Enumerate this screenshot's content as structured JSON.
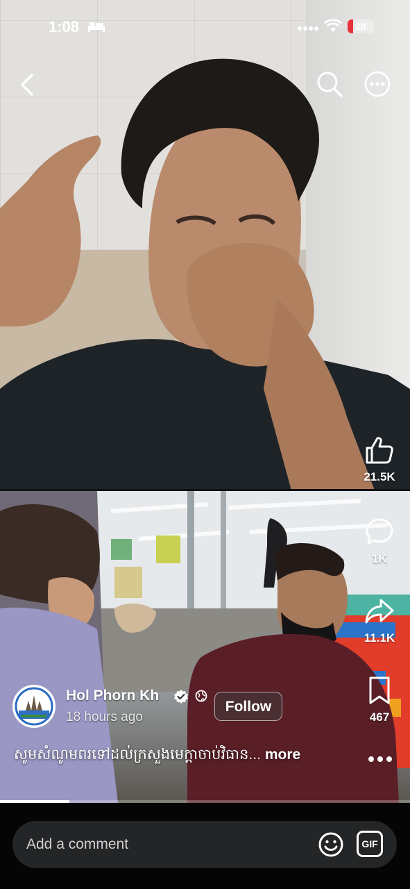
{
  "status_bar": {
    "time": "1:08",
    "battery_percent": 20,
    "battery_label": "20",
    "battery_color": "#e5323b",
    "icons": [
      "bed-icon",
      "signal-icon",
      "wifi-icon",
      "battery-icon"
    ]
  },
  "header": {
    "icons": [
      "back-icon",
      "search-icon",
      "more-circle-icon"
    ]
  },
  "actions": {
    "like_count": "21.5K",
    "comment_count": "1K",
    "share_count": "11.1K",
    "save_count": "467"
  },
  "post": {
    "author": "Hol Phorn Kh",
    "time_ago": "18 hours ago",
    "follow_label": "Follow",
    "caption": "សូមសំណូមពរទៅដល់ក្រសួងមេក្តាចាប់វិធាន...",
    "more_label": "more"
  },
  "playback": {
    "progress_fraction": 0.17
  },
  "comment_bar": {
    "placeholder": "Add a comment",
    "gif_label": "GIF"
  }
}
